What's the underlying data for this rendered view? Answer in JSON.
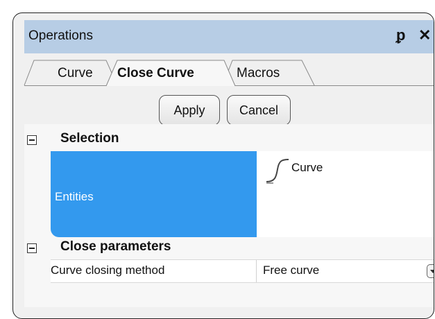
{
  "window": {
    "title": "Operations",
    "pin_icon": "pin-icon",
    "close_icon": "close-icon"
  },
  "tabs": [
    {
      "label": "Curve",
      "active": false
    },
    {
      "label": "Close Curve",
      "active": true
    },
    {
      "label": "Macros",
      "active": false
    }
  ],
  "buttons": {
    "apply": "Apply",
    "cancel": "Cancel"
  },
  "grid": {
    "selection": {
      "title": "Selection",
      "entities_label": "Entities",
      "entities_value": "Curve",
      "entity_icon": "curve-icon"
    },
    "close_params": {
      "title": "Close parameters",
      "method_label": "Curve closing method",
      "method_value": "Free curve"
    }
  },
  "colors": {
    "titlebar": "#b7cde5",
    "selected_row": "#3399ee"
  }
}
